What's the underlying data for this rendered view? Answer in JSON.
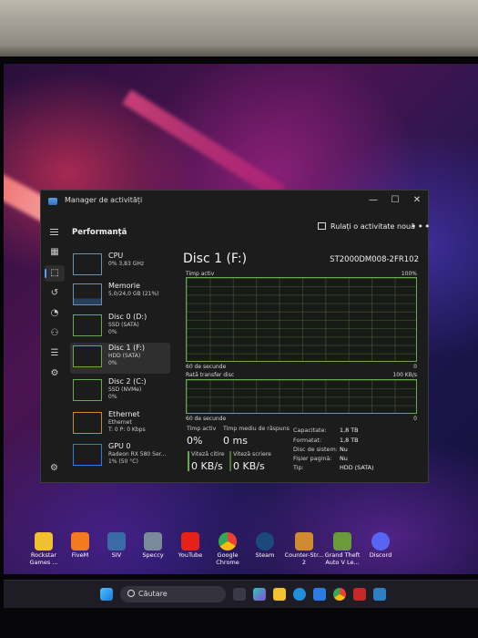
{
  "window": {
    "title": "Manager de activități",
    "page_title": "Performanță",
    "run_task_label": "Rulați o activitate nouă",
    "more_label": "•••",
    "controls": {
      "minimize": "—",
      "maximize": "☐",
      "close": "✕"
    }
  },
  "devices": [
    {
      "name": "CPU",
      "line2": "0% 3,83 GHz",
      "line3": ""
    },
    {
      "name": "Memorie",
      "line2": "5,0/24,0 GB (21%)",
      "line3": ""
    },
    {
      "name": "Disc 0 (D:)",
      "line2": "SSD (SATA)",
      "line3": "0%"
    },
    {
      "name": "Disc 1 (F:)",
      "line2": "HDD (SATA)",
      "line3": "0%"
    },
    {
      "name": "Disc 2 (C:)",
      "line2": "SSD (NVMe)",
      "line3": "0%"
    },
    {
      "name": "Ethernet",
      "line2": "Ethernet",
      "line3": "T: 0 P: 0 Kbps"
    },
    {
      "name": "GPU 0",
      "line2": "Radeon RX 580 Ser...",
      "line3": "1% (50 °C)"
    }
  ],
  "detail": {
    "title": "Disc 1 (F:)",
    "model": "ST2000DM008-2FR102",
    "graph1": {
      "label": "Timp activ",
      "max": "100%",
      "time": "60 de secunde",
      "min": "0"
    },
    "graph2": {
      "label": "Rată transfer disc",
      "max": "100 KB/s",
      "time": "60 de secunde",
      "min": "0"
    },
    "stats": {
      "active_time_label": "Timp activ",
      "active_time_value": "0%",
      "response_label": "Timp mediu de răspuns",
      "response_value": "0 ms",
      "read_label": "Viteză citire",
      "read_value": "0 KB/s",
      "write_label": "Viteză scriere",
      "write_value": "0 KB/s"
    },
    "properties": [
      {
        "key": "Capacitate:",
        "value": "1,8 TB"
      },
      {
        "key": "Formatat:",
        "value": "1,8 TB"
      },
      {
        "key": "Disc de sistem:",
        "value": "Nu"
      },
      {
        "key": "Fișier pagină:",
        "value": "Nu"
      },
      {
        "key": "Tip:",
        "value": "HDD (SATA)"
      }
    ]
  },
  "desktop_icons": [
    {
      "label": "Rockstar Games ..."
    },
    {
      "label": "FiveM"
    },
    {
      "label": "SIV"
    },
    {
      "label": "Speccy"
    },
    {
      "label": "YouTube"
    },
    {
      "label": "Google Chrome"
    },
    {
      "label": "Steam"
    },
    {
      "label": "Counter-Str... 2"
    },
    {
      "label": "Grand Theft Auto V Le..."
    },
    {
      "label": "Discord"
    }
  ],
  "taskbar": {
    "search_placeholder": "Căutare"
  },
  "colors": {
    "disk_accent": "#6aa84f",
    "nav_accent": "#4ca0ff",
    "window_bg": "#1c1c1c"
  }
}
